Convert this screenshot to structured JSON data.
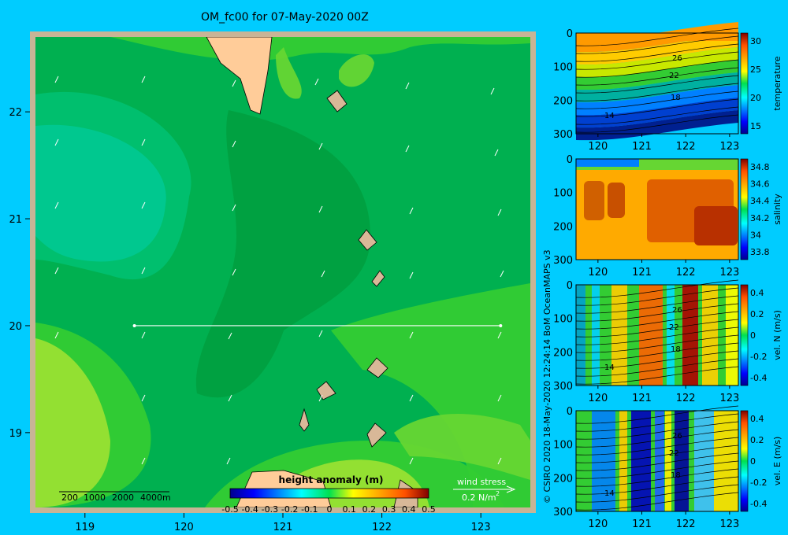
{
  "title": "OM_fc00 for 07-May-2020 00Z",
  "credit": "© CSIRO 2020   18-May-2020 12:24:14 BoM OceanMAPS v3",
  "colors": {
    "background": "#00ccff",
    "land": "#ffcc99",
    "island": "#d8b898",
    "map_frame": "#c8b496",
    "section_line": "#ffffff"
  },
  "main_map": {
    "x_ticks": [
      "119",
      "120",
      "121",
      "122",
      "123"
    ],
    "y_ticks": [
      "19",
      "20",
      "21",
      "22"
    ],
    "scale_bar_labels": [
      "200",
      "1000",
      "2000",
      "4000m"
    ],
    "wind_stress_label": "wind stress",
    "wind_stress_value": "0.2 N/m",
    "wind_stress_exponent": "2",
    "section_latitude": 20
  },
  "chart_data": [
    {
      "type": "heatmap",
      "name": "sea surface height anomaly",
      "title": "height anomaly  (m)",
      "x_range": [
        118.5,
        123.5
      ],
      "y_range": [
        18.3,
        22.7
      ],
      "x_ticks": [
        119,
        120,
        121,
        122,
        123
      ],
      "y_ticks": [
        19,
        20,
        21,
        22
      ],
      "colorbar_range": [
        -0.5,
        0.5
      ],
      "colorbar_ticks": [
        "-0.5",
        "-0.4",
        "-0.3",
        "-0.2",
        "-0.1",
        "0",
        "0.1",
        "0.2",
        "0.3",
        "0.4",
        "0.5"
      ],
      "approx_values": {
        "west_basin": 0.0,
        "central": 0.05,
        "east": 0.07,
        "south_east": 0.15,
        "south_west": 0.12
      }
    },
    {
      "type": "heatmap",
      "name": "temperature section",
      "colorbar_label": "temperature",
      "x_range": [
        119.5,
        123.2
      ],
      "y_range": [
        0,
        300
      ],
      "x_ticks": [
        "120",
        "121",
        "122",
        "123"
      ],
      "y_ticks": [
        "0",
        "100",
        "200",
        "300"
      ],
      "colorbar_ticks": [
        "30",
        "25",
        "20",
        "15"
      ],
      "colorbar_range": [
        13,
        31
      ],
      "contour_labels": [
        "26",
        "22",
        "18",
        "14"
      ]
    },
    {
      "type": "heatmap",
      "name": "salinity section",
      "colorbar_label": "salinity",
      "x_range": [
        119.5,
        123.2
      ],
      "y_range": [
        0,
        300
      ],
      "x_ticks": [
        "120",
        "121",
        "122",
        "123"
      ],
      "y_ticks": [
        "0",
        "100",
        "200",
        "300"
      ],
      "colorbar_ticks": [
        "34.8",
        "34.6",
        "34.4",
        "34.2",
        "34",
        "33.8"
      ],
      "colorbar_range": [
        33.7,
        34.9
      ]
    },
    {
      "type": "heatmap",
      "name": "north velocity section",
      "colorbar_label": "vel. N  (m/s)",
      "x_range": [
        119.5,
        123.2
      ],
      "y_range": [
        0,
        300
      ],
      "x_ticks": [
        "120",
        "121",
        "122",
        "123"
      ],
      "y_ticks": [
        "0",
        "100",
        "200",
        "300"
      ],
      "colorbar_ticks": [
        "0.4",
        "0.2",
        "0",
        "-0.2",
        "-0.4"
      ],
      "colorbar_range": [
        -0.5,
        0.5
      ],
      "contour_labels": [
        "26",
        "22",
        "18",
        "14"
      ]
    },
    {
      "type": "heatmap",
      "name": "east velocity section",
      "colorbar_label": "vel. E  (m/s)",
      "x_range": [
        119.5,
        123.2
      ],
      "y_range": [
        0,
        300
      ],
      "x_ticks": [
        "120",
        "121",
        "122",
        "123"
      ],
      "y_ticks": [
        "0",
        "100",
        "200",
        "300"
      ],
      "colorbar_ticks": [
        "0.4",
        "0.2",
        "0",
        "-0.2",
        "-0.4"
      ],
      "colorbar_range": [
        -0.5,
        0.5
      ],
      "contour_labels": [
        "26",
        "22",
        "18",
        "14"
      ]
    }
  ]
}
